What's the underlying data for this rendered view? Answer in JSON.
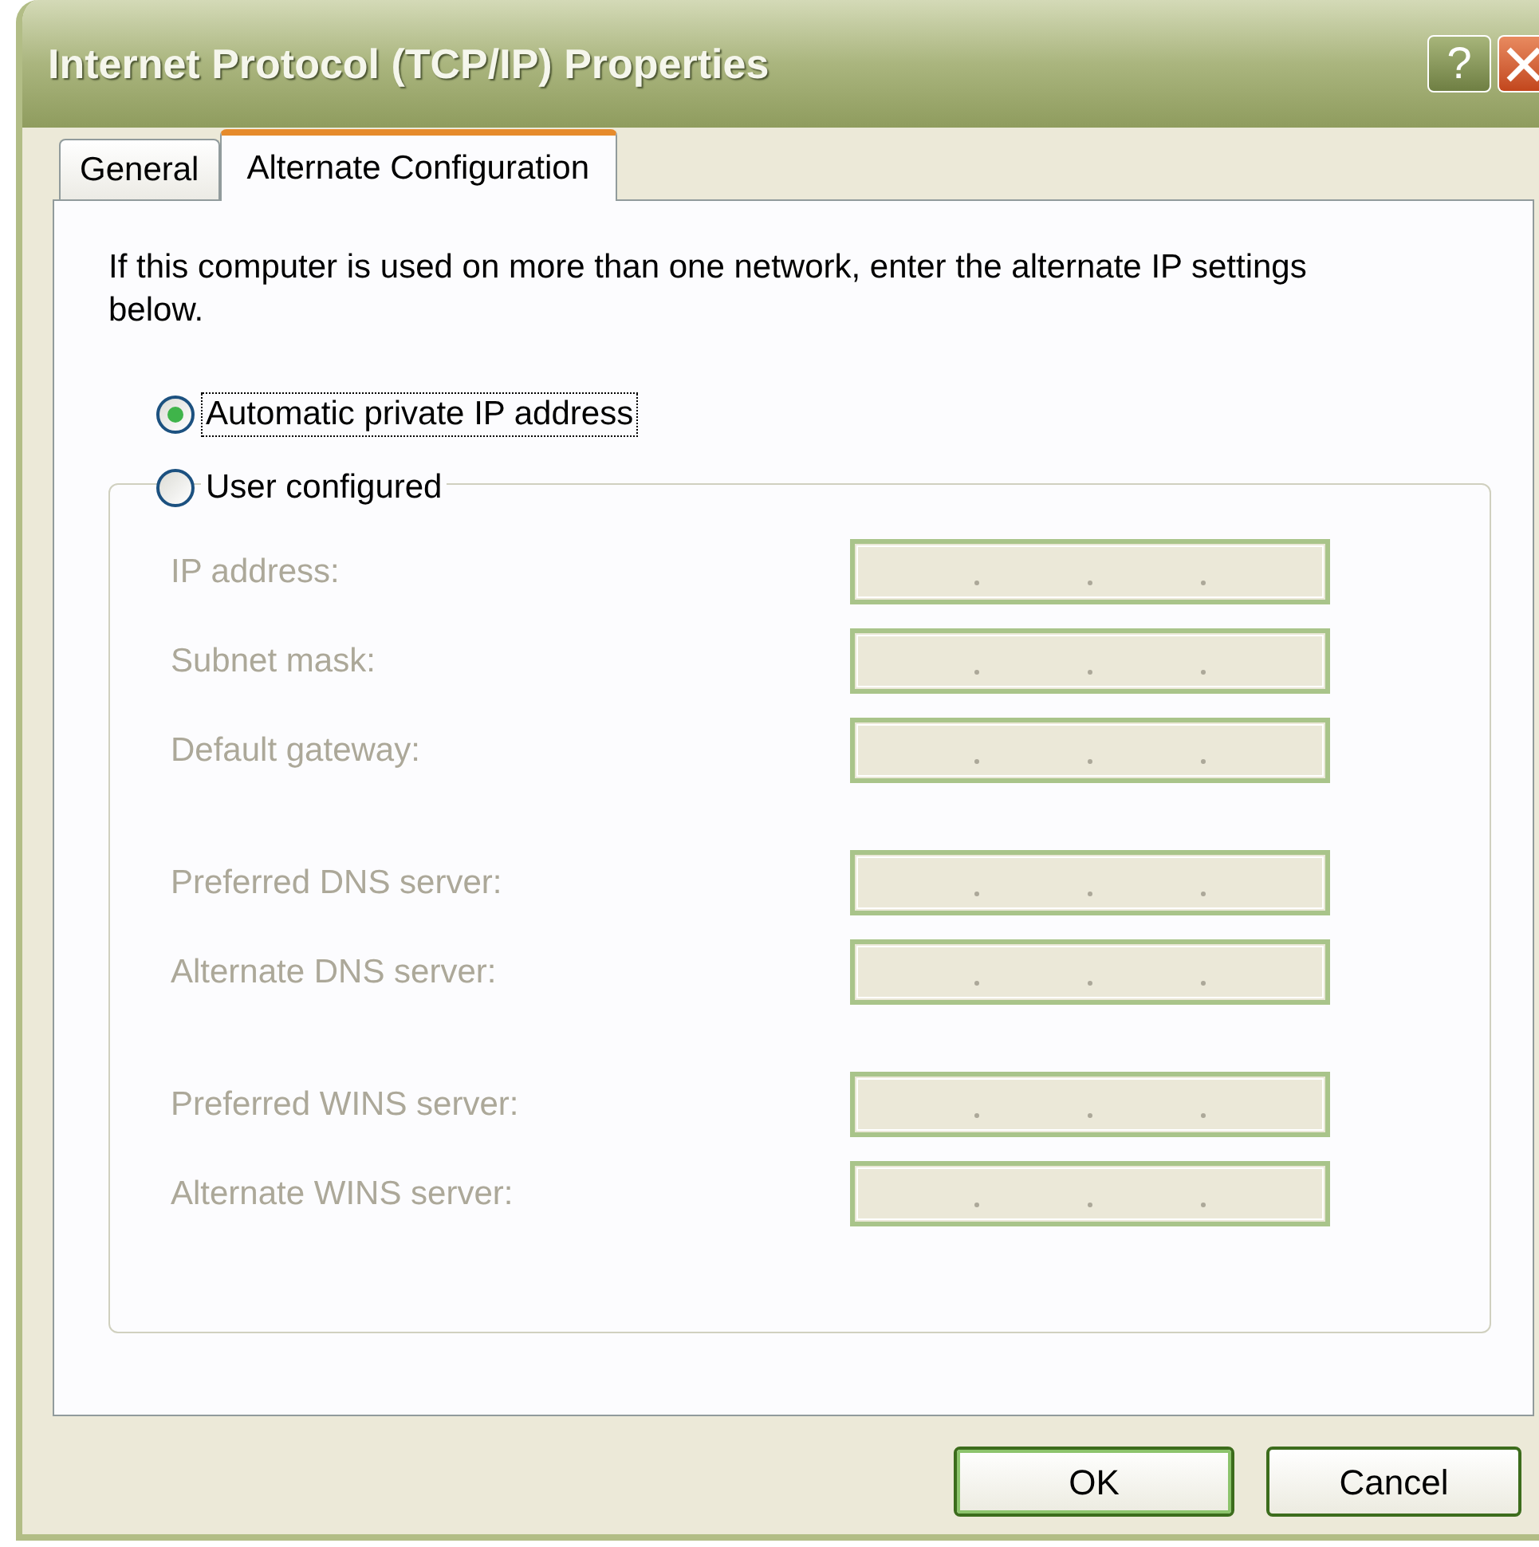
{
  "window": {
    "title": "Internet Protocol (TCP/IP) Properties",
    "help_button": "?"
  },
  "tabs": [
    {
      "label": "General",
      "selected": false
    },
    {
      "label": "Alternate Configuration",
      "selected": true
    }
  ],
  "intro": "If this computer is used on more than one network, enter the alternate IP settings below.",
  "options": [
    {
      "label": "Automatic private IP address",
      "selected": true,
      "focused": true
    },
    {
      "label": "User configured",
      "selected": false,
      "focused": false
    }
  ],
  "group": {
    "disabled": true,
    "sections": [
      [
        {
          "label": "IP address:"
        },
        {
          "label": "Subnet mask:"
        },
        {
          "label": "Default gateway:"
        }
      ],
      [
        {
          "label": "Preferred DNS server:"
        },
        {
          "label": "Alternate DNS server:"
        }
      ],
      [
        {
          "label": "Preferred WINS server:"
        },
        {
          "label": "Alternate WINS server:"
        }
      ]
    ]
  },
  "buttons": [
    {
      "label": "OK",
      "default": true
    },
    {
      "label": "Cancel",
      "default": false
    }
  ]
}
